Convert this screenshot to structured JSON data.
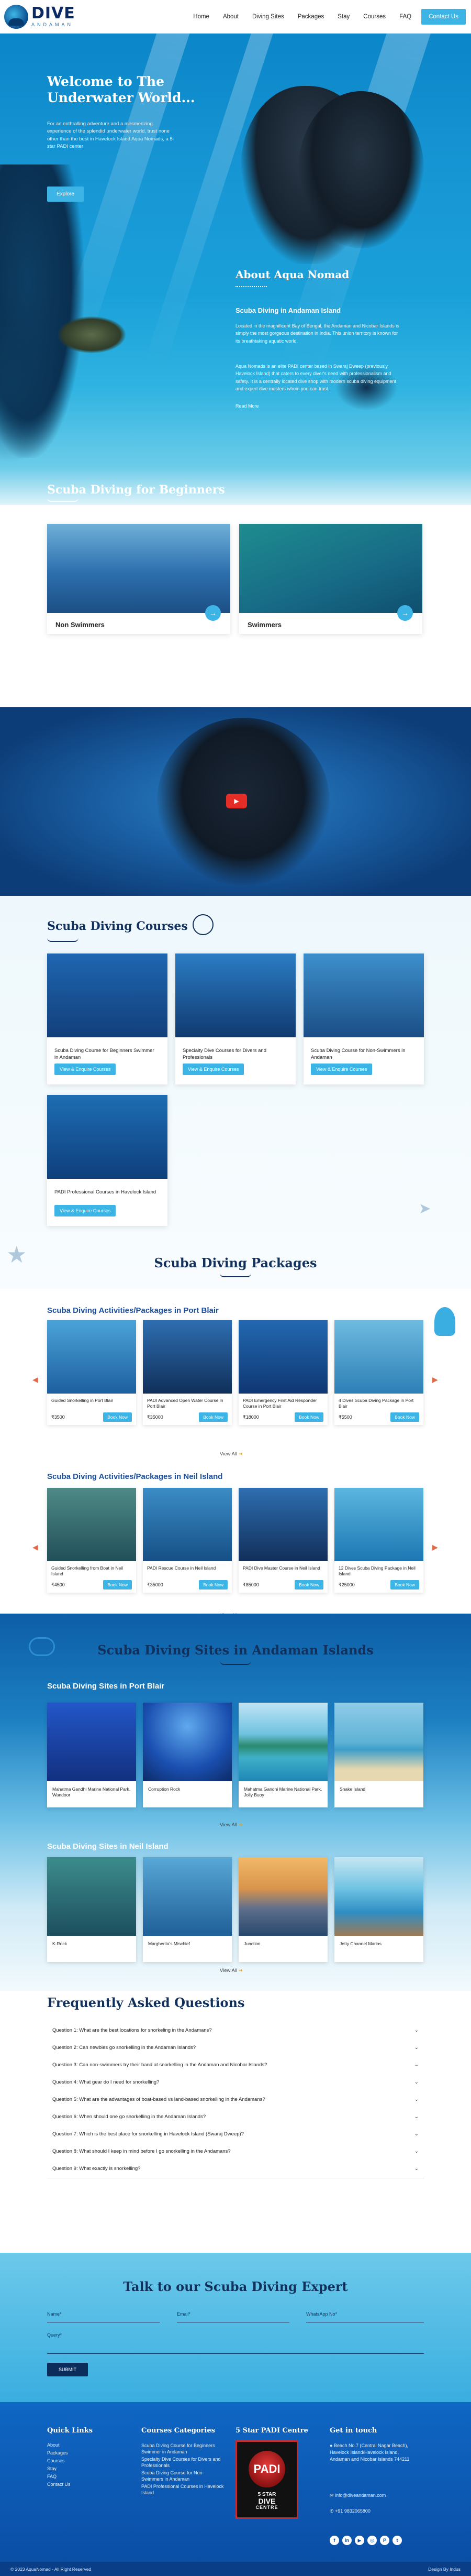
{
  "brand": {
    "name": "DIVE",
    "sub": "ANDAMAN"
  },
  "nav": {
    "items": [
      "Home",
      "About",
      "Diving Sites",
      "Packages",
      "Stay",
      "Courses",
      "FAQ"
    ],
    "cta": "Contact Us"
  },
  "hero": {
    "title_line1": "Welcome to The",
    "title_line2": "Underwater World...",
    "description": "For an enthralling adventure and a mesmerizing experience of the splendid underwater world, trust none other than the best in Havelock Island Aqua Nomads, a 5-star PADI center",
    "button": "Explore"
  },
  "about": {
    "title": "About Aqua Nomad",
    "subtitle": "Scuba Diving in Andaman Island",
    "p1": "Located in the magnificent Bay of Bengal, the Andaman and Nicobar Islands is simply the most gorgeous destination in India. This union territory is known for its breathtaking aquatic world.",
    "p2": "Aqua Nomads is an elite PADI center based in Swaraj Dweep (previously Havelock Island) that caters to every diver's need with professionalism and safety. It is a centrally located dive shop with modern scuba diving equipment and expert dive masters whom you can trust.",
    "readmore": "Read More"
  },
  "beginners": {
    "title": "Scuba Diving for Beginners",
    "cards": [
      {
        "label": "Non Swimmers",
        "color": "#2a75b5"
      },
      {
        "label": "Swimmers",
        "color": "#1e8c8f"
      }
    ]
  },
  "video": {
    "play_icon": "play-icon"
  },
  "courses": {
    "title": "Scuba Diving Courses",
    "button": "View & Enquire Courses",
    "cards": [
      {
        "title": "Scuba Diving Course for Beginners Swimmer in Andaman",
        "color": "#1f66b1"
      },
      {
        "title": "Specialty Dive Courses for Divers and Professionals",
        "color": "#1a5aa8"
      },
      {
        "title": "Scuba Diving Course for Non-Swimmers in Andaman",
        "color": "#2c7cbf"
      },
      {
        "title": "PADI Professional Courses in Havelock Island",
        "color": "#1e6db3"
      }
    ]
  },
  "packages": {
    "title": "Scuba Diving Packages",
    "book": "Book Now",
    "view_all": "View All",
    "groups": [
      {
        "heading": "Scuba Diving Activities/Packages in Port Blair",
        "items": [
          {
            "title": "Guided Snorkelling in Port Blair",
            "price": "₹3500",
            "color": "#2f86c6"
          },
          {
            "title": "PADI Advanced Open Water Course in Port Blair",
            "price": "₹35000",
            "color": "#1e5d9e"
          },
          {
            "title": "PADI Emergency First Aid Responder Course in Port Blair",
            "price": "₹18000",
            "color": "#2268b0"
          },
          {
            "title": "4 Dives Scuba Diving Package in Port Blair",
            "price": "₹5500",
            "color": "#4aa3cf"
          }
        ]
      },
      {
        "heading": "Scuba Diving Activities/Packages in Neil Island",
        "items": [
          {
            "title": "Guided Snorkelling from Boat in Neil Island",
            "price": "₹4500",
            "color": "#2e6f8a"
          },
          {
            "title": "PADI Rescue Course in Neil Island",
            "price": "₹35000",
            "color": "#2a7ab8"
          },
          {
            "title": "PADI Dive Master Course in Neil Island",
            "price": "₹85000",
            "color": "#1e5d9e"
          },
          {
            "title": "12 Dives Scuba Diving Package in Neil Island",
            "price": "₹25000",
            "color": "#2d8fc9"
          }
        ]
      }
    ]
  },
  "sites": {
    "title": "Scuba Diving Sites in Andaman Islands",
    "view_all": "View All",
    "groups": [
      {
        "heading": "Scuba Diving Sites in Port Blair",
        "items": [
          {
            "title": "Mahatma Gandhi Marine National Park, Wandoor",
            "color": "#1d4fb3"
          },
          {
            "title": "Corruption Rock",
            "color": "#1c56b0"
          },
          {
            "title": "Mahatma Gandhi Marine National Park, Jolly Buoy",
            "color": "#3b9fc2"
          },
          {
            "title": "Snake Island",
            "color": "#3f9ccc"
          }
        ]
      },
      {
        "heading": "Scuba Diving Sites in Neil Island",
        "items": [
          {
            "title": "K-Rock",
            "color": "#2b6f82"
          },
          {
            "title": "Margherita's Mischief",
            "color": "#2e7fb5"
          },
          {
            "title": "Junction",
            "color": "#d9944c"
          },
          {
            "title": "Jetty Channel Marias",
            "color": "#2f8ec4"
          }
        ]
      }
    ]
  },
  "faq": {
    "title": "Frequently Asked Questions",
    "items": [
      "Question 1: What are the best locations for snorkeling in the Andamans?",
      "Question 2: Can newbies go snorkelling in the Andaman Islands?",
      "Question 3: Can non-swimmers try their hand at snorkelling in the Andaman and Nicobar Islands?",
      "Question 4: What gear do I need for snorkelling?",
      "Question 5: What are the advantages of boat-based vs land-based snorkelling in the Andamans?",
      "Question 6: When should one go snorkelling in the Andaman Islands?",
      "Question 7: Which is the best place for snorkelling in Havelock Island (Swaraj Dweep)?",
      "Question 8: What should I keep in mind before I go snorkelling in the Andamans?",
      "Question 9: What exactly is snorkelling?"
    ]
  },
  "contact": {
    "title": "Talk to our Scuba Diving Expert",
    "name": "Name*",
    "email": "Email*",
    "whatsapp": "WhatsApp No*",
    "query": "Query*",
    "submit": "SUBMIT"
  },
  "footer": {
    "quick_title": "Quick Links",
    "quick": [
      "About",
      "Packages",
      "Courses",
      "Stay",
      "FAQ",
      "Contact Us"
    ],
    "cat_title": "Courses Categories",
    "cats": [
      "Scuba Diving Course for Beginners Swimmer in Andaman",
      "Specialty Dive Courses for Divers and Professionals",
      "Scuba Diving Course for Non-Swimmers in Andaman",
      "PADI Professional Courses in Havelock Island"
    ],
    "padi_title": "5 Star PADI Centre",
    "padi": {
      "brand": "PADI",
      "l1": "5 STAR",
      "l2": "DIVE",
      "l3": "CENTRE"
    },
    "touch_title": "Get in touch",
    "address": "Beach No.7 (Central Nagar Beach), Havelock Island/Havelock Island, Andaman and Nicobar Islands 744211",
    "email": "info@diveandaman.com",
    "phone": "+91 9832065800",
    "copyright": "© 2023 AquaNomad - All Right Reserved",
    "design": "Design By Indus"
  }
}
